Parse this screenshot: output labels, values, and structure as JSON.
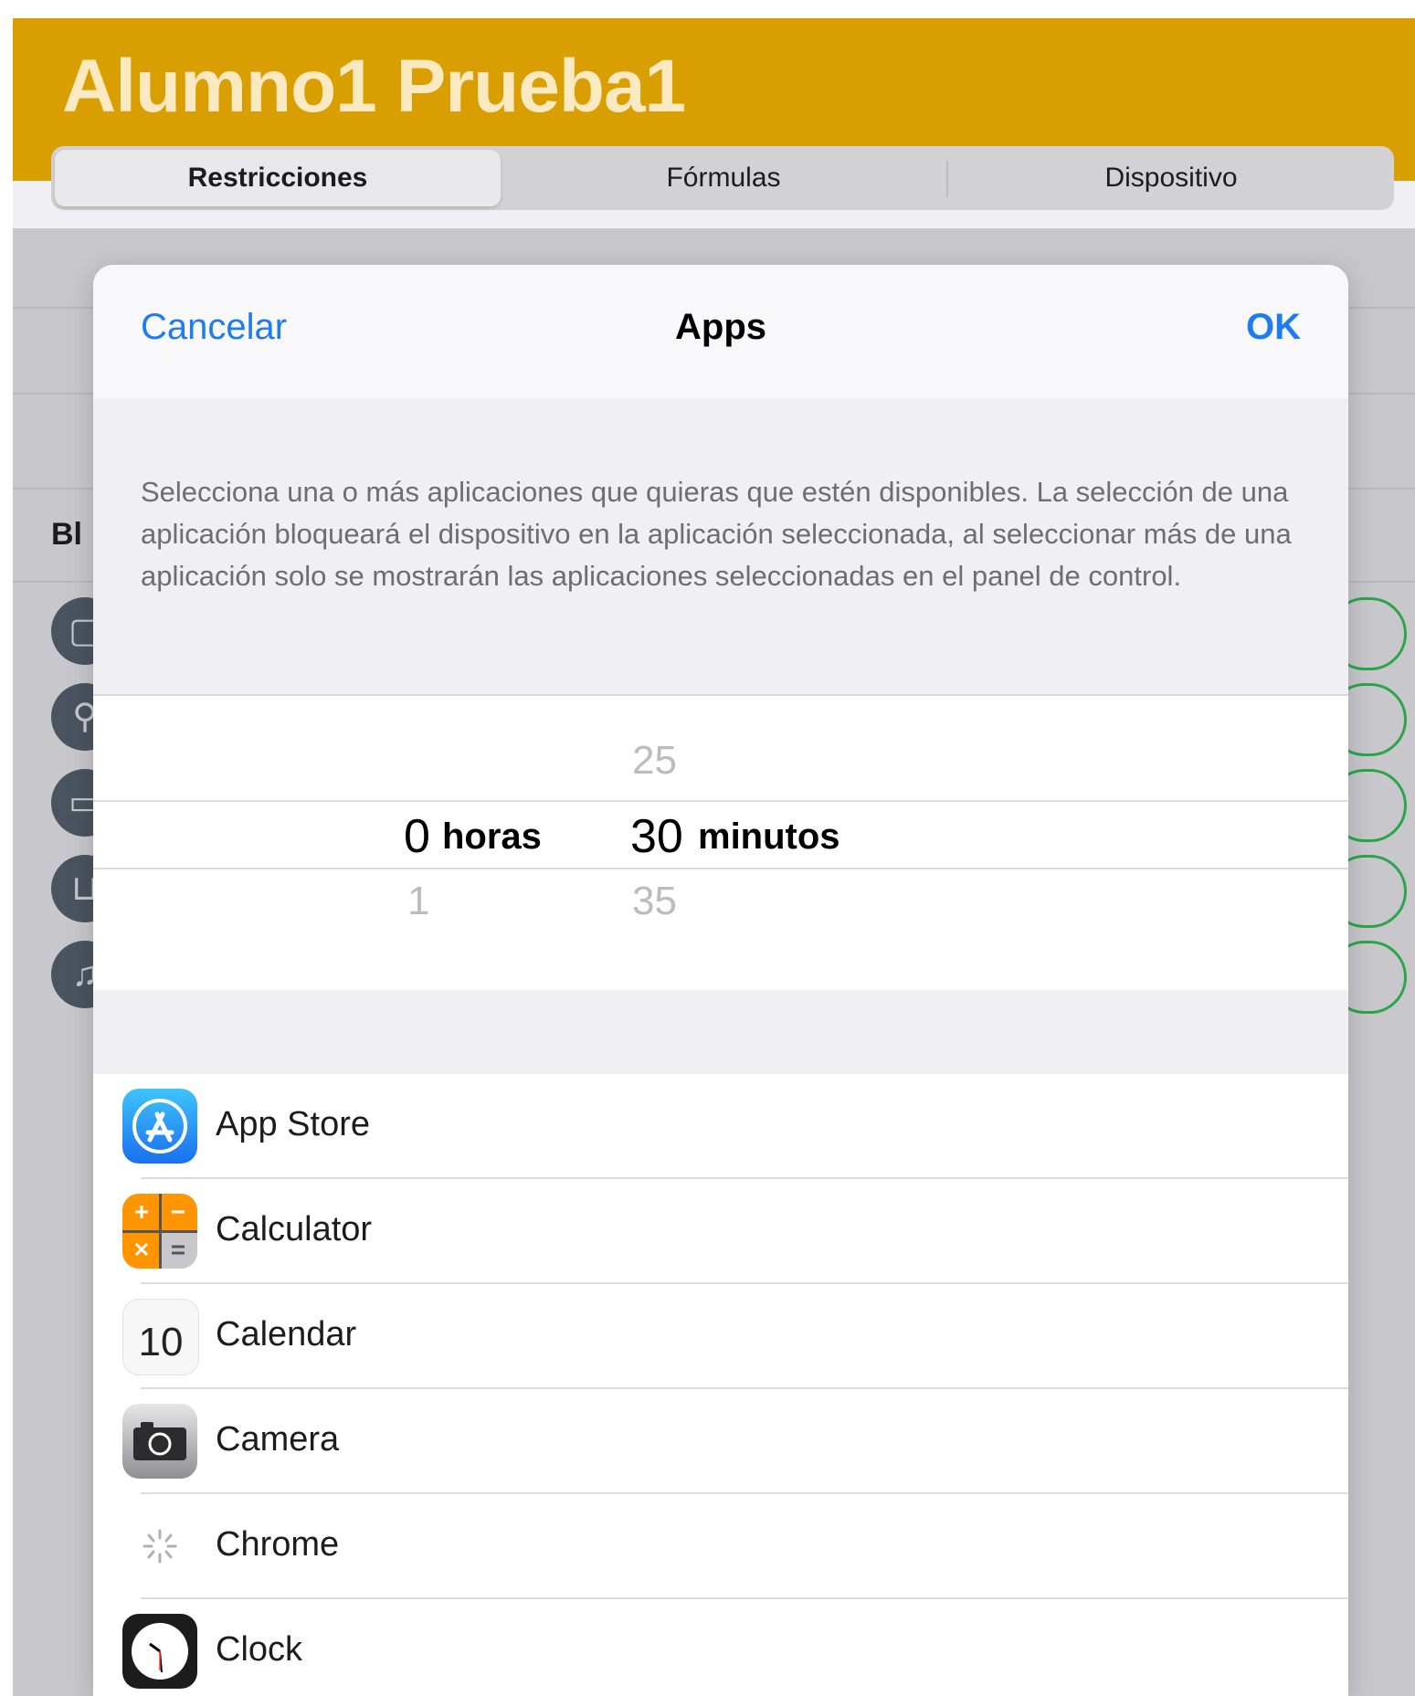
{
  "background": {
    "title": "Alumno1 Prueba1",
    "tabs": [
      "Restricciones",
      "Fórmulas",
      "Dispositivo"
    ],
    "section_label_partial": "Bl"
  },
  "modal": {
    "cancel_label": "Cancelar",
    "title": "Apps",
    "ok_label": "OK",
    "description": "Selecciona una o más aplicaciones que quieras que estén disponibles. La selección de una aplicación bloqueará el dispositivo en la aplicación seleccionada, al seleccionar más de una aplicación solo se mostrarán las aplicaciones seleccionadas en el panel de control.",
    "picker": {
      "hours_selected": "0",
      "hours_unit": "horas",
      "hours_next": "1",
      "minutes_prev": "25",
      "minutes_selected": "30",
      "minutes_unit": "minutos",
      "minutes_next": "35"
    },
    "apps": [
      {
        "name": "App Store",
        "icon": "app-store-icon"
      },
      {
        "name": "Calculator",
        "icon": "calculator-icon"
      },
      {
        "name": "Calendar",
        "icon": "calendar-icon",
        "icon_day": "10"
      },
      {
        "name": "Camera",
        "icon": "camera-icon"
      },
      {
        "name": "Chrome",
        "icon": "loading-spinner-icon"
      },
      {
        "name": "Clock",
        "icon": "clock-icon"
      }
    ]
  },
  "colors": {
    "header": "#d99e00",
    "accent_blue": "#1e7cf0",
    "toggle_green": "#2aa54a"
  }
}
